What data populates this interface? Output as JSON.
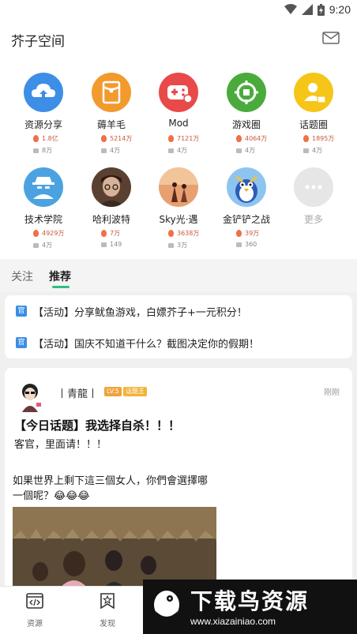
{
  "status": {
    "time": "9:20"
  },
  "header": {
    "title": "芥子空间",
    "mail_icon": "mail-icon"
  },
  "circles": [
    {
      "name": "资源分享",
      "hot": "1.8亿",
      "count": "8万",
      "icon": "cloud-upload-icon",
      "color": "#3d8ee6"
    },
    {
      "name": "薅羊毛",
      "hot": "5214万",
      "count": "4万",
      "icon": "red-envelope-icon",
      "color": "#f29a2e"
    },
    {
      "name": "Mod",
      "hot": "7121万",
      "count": "4万",
      "icon": "gamepad-icon",
      "color": "#e84a4a"
    },
    {
      "name": "游戏圈",
      "hot": "4064万",
      "count": "4万",
      "icon": "game-circle-icon",
      "color": "#4aab3c"
    },
    {
      "name": "话题圈",
      "hot": "1895万",
      "count": "4万",
      "icon": "topic-user-icon",
      "color": "#f5c518"
    },
    {
      "name": "技术学院",
      "hot": "4929万",
      "count": "4万",
      "icon": "spy-icon",
      "color": "#4aa3e0"
    },
    {
      "name": "哈利波特",
      "hot": "7万",
      "count": "149",
      "icon": "harry-potter-icon",
      "color": "#5a4030"
    },
    {
      "name": "Sky光·遇",
      "hot": "3638万",
      "count": "3万",
      "icon": "sky-icon",
      "color": "#c4623e"
    },
    {
      "name": "金铲铲之战",
      "hot": "39万",
      "count": "360",
      "icon": "penguin-icon",
      "color": "#3a66c4"
    },
    {
      "name": "更多",
      "hot": "",
      "count": "",
      "icon": "more-icon",
      "color": "#e6e6e6"
    }
  ],
  "tabs": {
    "follow": "关注",
    "recommend": "推荐"
  },
  "announcements": [
    {
      "tag": "官",
      "text": "【活动】分享鱿鱼游戏，白嫖芥子+一元积分！"
    },
    {
      "tag": "官",
      "text": "【活动】国庆不知道干什么？截图决定你的假期！"
    }
  ],
  "post": {
    "user": "丨青龍丨",
    "level": "LV.5",
    "badge": "话题王",
    "time": "刚刚",
    "title": "【今日话题】我选择自杀！！！",
    "body": "客官，里面请！！！",
    "caption": "如果世界上剩下這三個女人，你們會選擇哪一個呢？😂😂😂"
  },
  "bottom_nav": [
    {
      "label": "资源",
      "icon": "code-icon"
    },
    {
      "label": "发现",
      "icon": "star-bookmark-icon"
    }
  ],
  "promo": {
    "title": "下载鸟资源",
    "url": "www.xiazainiao.com"
  }
}
